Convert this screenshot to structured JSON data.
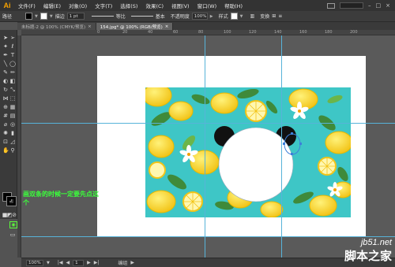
{
  "app": {
    "logo": "Ai"
  },
  "menu": {
    "items": [
      "文件(F)",
      "编辑(E)",
      "对象(O)",
      "文字(T)",
      "选择(S)",
      "效果(C)",
      "视图(V)",
      "窗口(W)",
      "帮助(H)"
    ]
  },
  "control_bar": {
    "selection_label": "路径",
    "stroke_label": "描边",
    "stroke_weight": "1 pt",
    "profile_label": "等比",
    "brush_label": "基本",
    "opacity_label": "不透明度",
    "opacity_value": "100%",
    "style_label": "样式",
    "transform_label": "变换"
  },
  "tabs": [
    {
      "label": "未标题-2 @ 100% (CMYK/预览)",
      "active": false
    },
    {
      "label": "154.jpg* @ 100% (RGB/预览)",
      "active": true
    }
  ],
  "ruler_marks": [
    "0",
    "10",
    "20",
    "30",
    "40",
    "50",
    "60",
    "70",
    "80",
    "90",
    "100",
    "110",
    "120",
    "130",
    "140",
    "150",
    "160",
    "170",
    "180",
    "190",
    "200",
    "210"
  ],
  "status_bar": {
    "zoom": "100%",
    "artboard": "1",
    "tool_name": "编组"
  },
  "annotation": {
    "text": "画双条的时候一定要先点这个",
    "color": "#3bff3b"
  },
  "watermark": {
    "url": "jb51.net",
    "title": "脚本之家"
  },
  "colors": {
    "accent": "#f7a200",
    "guide": "#57b3d9",
    "pattern_bg": "#3ec6c6",
    "lemon": "#f5d623",
    "leaf": "#3f8a3a"
  }
}
